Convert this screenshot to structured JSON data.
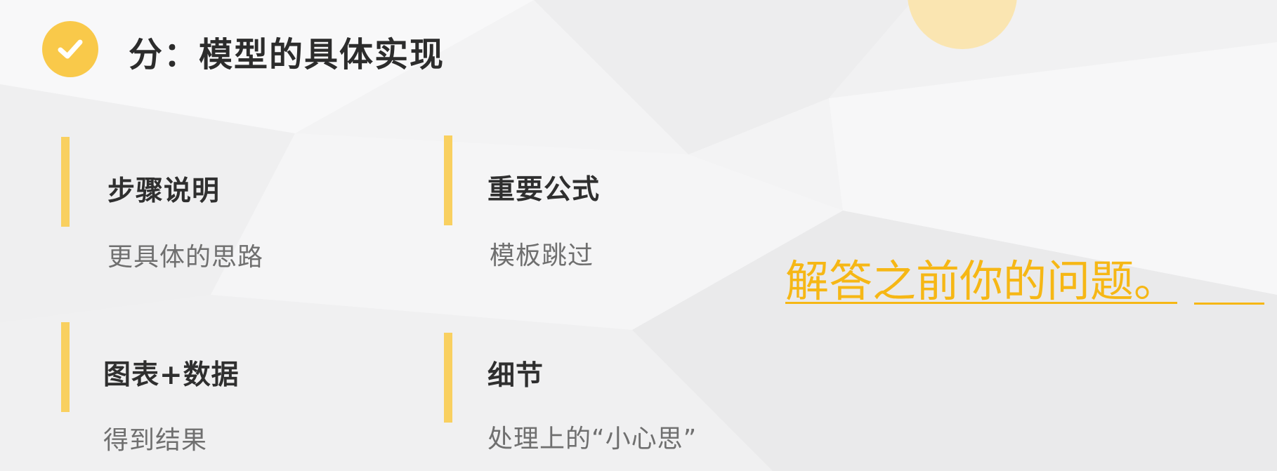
{
  "slide": {
    "title": "分：模型的具体实现",
    "accent_color": "#f9c94a",
    "check_icon": "check-icon"
  },
  "cards": [
    {
      "title": "步骤说明",
      "desc": "更具体的思路"
    },
    {
      "title": "重要公式",
      "desc": "模板跳过"
    },
    {
      "title": "图表+数据",
      "desc": "得到结果"
    },
    {
      "title": "细节",
      "desc": "处理上的“小心思”"
    }
  ],
  "annotation": {
    "text": "解答之前你的问题。",
    "color": "#f6b715"
  }
}
